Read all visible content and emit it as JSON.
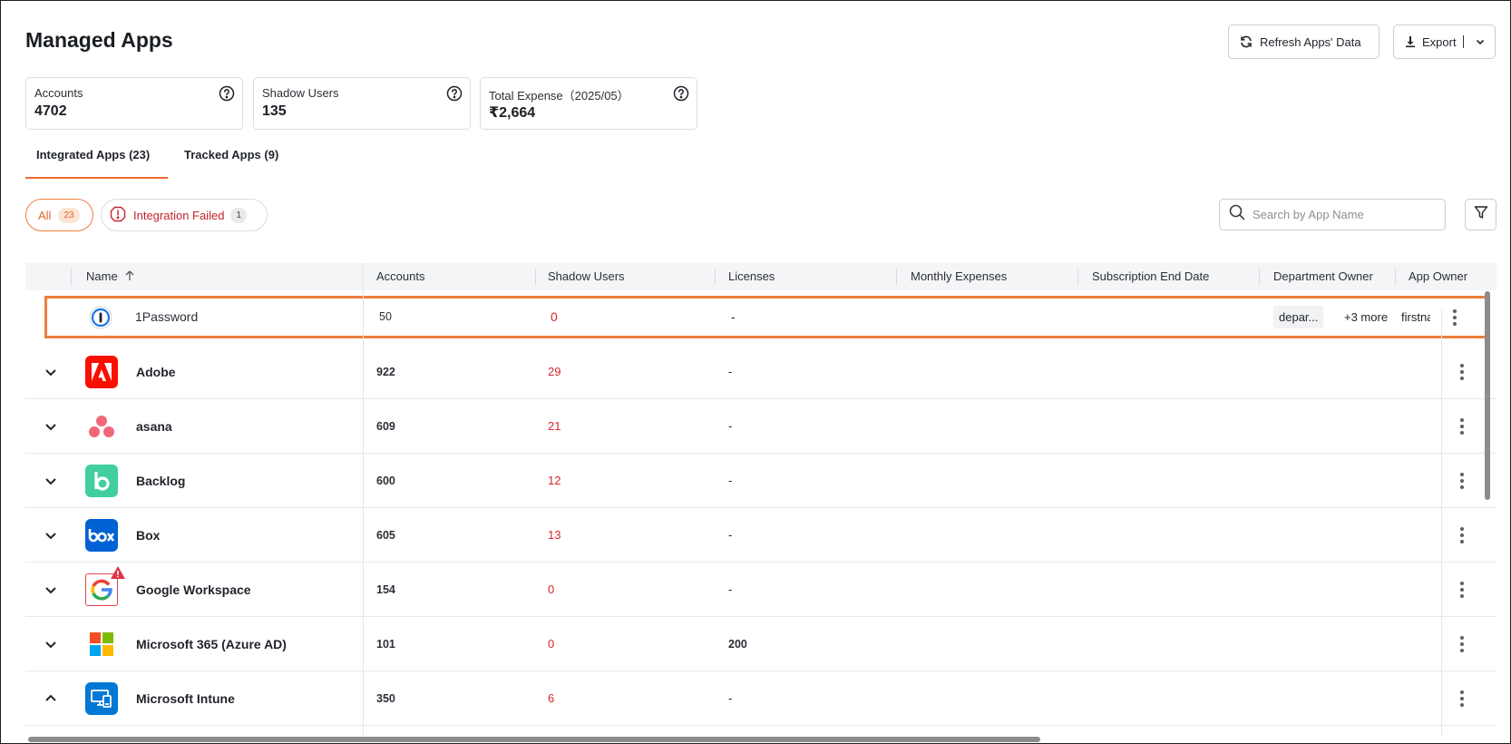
{
  "page": {
    "title": "Managed Apps"
  },
  "header": {
    "refresh_label": "Refresh Apps' Data",
    "export_label": "Export"
  },
  "stats": [
    {
      "label": "Accounts",
      "value": "4702"
    },
    {
      "label": "Shadow Users",
      "value": "135"
    },
    {
      "label": "Total Expense（2025/05）",
      "value": "₹2,664"
    }
  ],
  "tabs": [
    {
      "label": "Integrated Apps (23)",
      "active": true
    },
    {
      "label": "Tracked Apps (9)",
      "active": false
    }
  ],
  "filters": {
    "all_label": "All",
    "all_count": "23",
    "failed_label": "Integration Failed",
    "failed_count": "1"
  },
  "search": {
    "placeholder": "Search by App Name"
  },
  "table": {
    "columns": [
      "Name",
      "Accounts",
      "Shadow Users",
      "Licenses",
      "Monthly Expenses",
      "Subscription End Date",
      "Department Owner",
      "App Owner"
    ],
    "selected_row": {
      "name": "1Password",
      "accounts": "50",
      "shadow_users": "0",
      "licenses": "-",
      "department_owner": "depar...",
      "department_more": "+3 more",
      "app_owner": "firstna"
    },
    "rows": [
      {
        "name": "Adobe",
        "accounts": "922",
        "shadow_users": "29",
        "licenses": "-",
        "expanded": false,
        "icon": "adobe-icon"
      },
      {
        "name": "asana",
        "accounts": "609",
        "shadow_users": "21",
        "licenses": "-",
        "expanded": false,
        "icon": "asana-icon"
      },
      {
        "name": "Backlog",
        "accounts": "600",
        "shadow_users": "12",
        "licenses": "-",
        "expanded": false,
        "icon": "backlog-icon"
      },
      {
        "name": "Box",
        "accounts": "605",
        "shadow_users": "13",
        "licenses": "-",
        "expanded": false,
        "icon": "box-icon"
      },
      {
        "name": "Google Workspace",
        "accounts": "154",
        "shadow_users": "0",
        "licenses": "-",
        "expanded": false,
        "icon": "google-icon",
        "warning": true
      },
      {
        "name": "Microsoft 365 (Azure AD)",
        "accounts": "101",
        "shadow_users": "0",
        "licenses": "200",
        "expanded": false,
        "icon": "microsoft-icon"
      },
      {
        "name": "Microsoft Intune",
        "accounts": "350",
        "shadow_users": "6",
        "licenses": "-",
        "expanded": true,
        "icon": "intune-icon"
      }
    ]
  },
  "colors": {
    "accent": "#ef6c2b",
    "danger": "#d9262b",
    "adobe": "#fa0f00",
    "backlog": "#42ce9f",
    "box": "#0061d5",
    "intune": "#0078d4"
  }
}
